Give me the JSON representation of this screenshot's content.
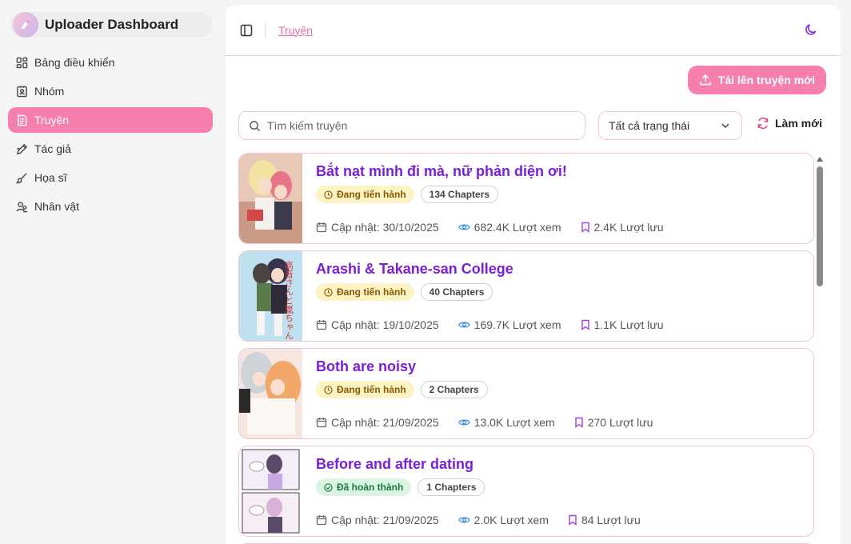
{
  "app": {
    "title": "Uploader Dashboard"
  },
  "sidebar": {
    "items": [
      {
        "label": "Bảng điều khiển",
        "icon": "dashboard-grid-icon",
        "active": false
      },
      {
        "label": "Nhóm",
        "icon": "group-badge-icon",
        "active": false
      },
      {
        "label": "Truyện",
        "icon": "book-icon",
        "active": true
      },
      {
        "label": "Tác giả",
        "icon": "pen-icon",
        "active": false
      },
      {
        "label": "Họa sĩ",
        "icon": "brush-icon",
        "active": false
      },
      {
        "label": "Nhân vật",
        "icon": "users-icon",
        "active": false
      }
    ]
  },
  "header": {
    "breadcrumb": "Truyện"
  },
  "toolbar": {
    "upload_label": "Tải lên truyện mới",
    "search_placeholder": "Tìm kiếm truyện",
    "status_select": "Tất cả trạng thái",
    "refresh_label": "Làm mới"
  },
  "colors": {
    "accent": "#f77fae",
    "title": "#7b1fd6",
    "border": "#f0c5d6"
  },
  "stories": [
    {
      "title": "Bắt nạt mình đi mà, nữ phản diện ơi!",
      "status": "Đang tiến hành",
      "status_type": "ongoing",
      "chapters": "134 Chapters",
      "updated": "Cập nhật: 30/10/2025",
      "views": "682.4K Lượt xem",
      "saves": "2.4K Lượt lưu"
    },
    {
      "title": "Arashi & Takane-san College",
      "status": "Đang tiến hành",
      "status_type": "ongoing",
      "chapters": "40 Chapters",
      "updated": "Cập nhật: 19/10/2025",
      "views": "169.7K Lượt xem",
      "saves": "1.1K Lượt lưu",
      "cover_text": "高音さんと嵐ちゃん"
    },
    {
      "title": "Both are noisy",
      "status": "Đang tiến hành",
      "status_type": "ongoing",
      "chapters": "2 Chapters",
      "updated": "Cập nhật: 21/09/2025",
      "views": "13.0K Lượt xem",
      "saves": "270 Lượt lưu"
    },
    {
      "title": "Before and after dating",
      "status": "Đã hoàn thành",
      "status_type": "done",
      "chapters": "1 Chapters",
      "updated": "Cập nhật: 21/09/2025",
      "views": "2.0K Lượt xem",
      "saves": "84 Lượt lưu"
    }
  ]
}
